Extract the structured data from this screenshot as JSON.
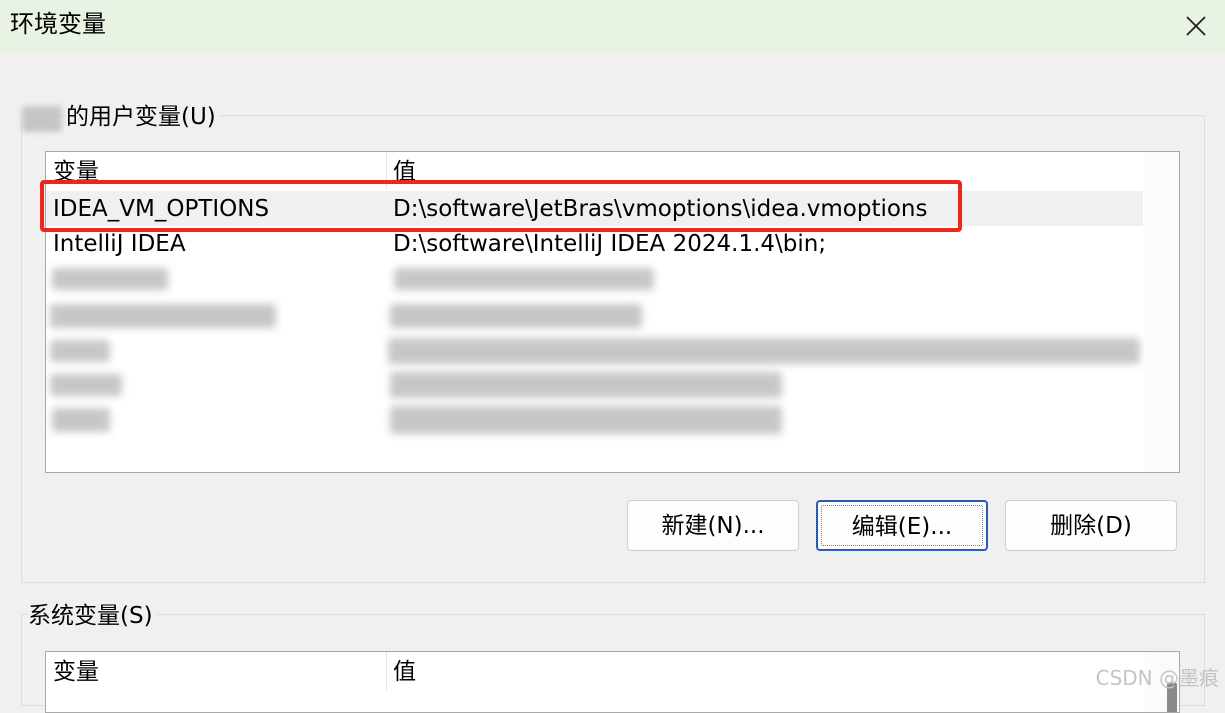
{
  "window": {
    "title": "环境变量"
  },
  "user_vars": {
    "group_label": "的用户变量(U)",
    "columns": {
      "name": "变量",
      "value": "值"
    },
    "rows": [
      {
        "name": "IDEA_VM_OPTIONS",
        "value": "D:\\software\\JetBras\\vmoptions\\idea.vmoptions"
      },
      {
        "name": "IntelliJ IDEA",
        "value": "D:\\software\\IntelliJ IDEA 2024.1.4\\bin;"
      }
    ],
    "highlight_color": "#f0261e"
  },
  "buttons": {
    "new": "新建(N)...",
    "edit": "编辑(E)...",
    "delete": "删除(D)"
  },
  "system_vars": {
    "group_label": "系统变量(S)",
    "columns": {
      "name": "变量",
      "value": "值"
    }
  },
  "watermark": "CSDN @墨痕"
}
